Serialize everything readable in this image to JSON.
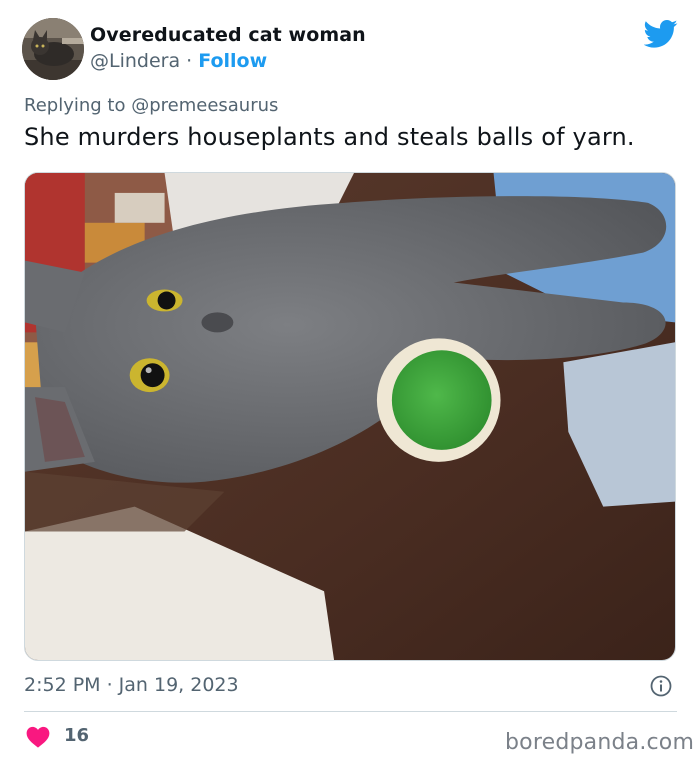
{
  "author": {
    "display_name": "Overeducated cat woman",
    "handle": "@Lindera",
    "separator": "·",
    "follow_label": "Follow",
    "avatar_icon": "cat-avatar-icon"
  },
  "reply": {
    "prefix": "Replying to ",
    "handle": "@premeesaurus"
  },
  "tweet": {
    "text": "She murders houseplants and steals balls of yarn.",
    "timestamp": "2:52 PM · Jan 19, 2023"
  },
  "engagement": {
    "likes": "16"
  },
  "watermark": "boredpanda.com",
  "icons": {
    "brand": "twitter-bird-icon",
    "info": "info-icon",
    "like": "heart-icon"
  },
  "colors": {
    "accent": "#1d9bf0",
    "secondary_text": "#536471",
    "heart": "#f91880"
  }
}
